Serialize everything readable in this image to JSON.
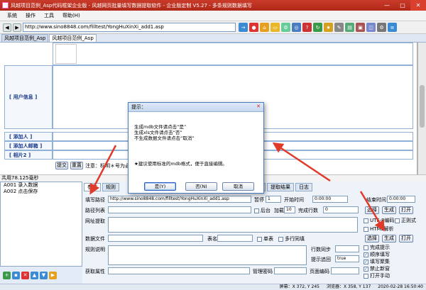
{
  "window": {
    "title": "风越项目范例_Asp代码框架企业版 - 风越网页批量填写数据提取软件 - 企业版定制 V5.27 - 多条规则数据填写"
  },
  "menu": {
    "items": [
      "系统",
      "操作",
      "工具",
      "帮助(H)"
    ]
  },
  "toolbar": {
    "url": "http://www.sino8848.com/filltest/YongHuXinXi_add1.asp",
    "icons": [
      "go-icon",
      "stop-icon",
      "home-icon",
      "folder-icon",
      "settings-icon",
      "globe-icon",
      "help-icon",
      "refresh-icon",
      "bookmark-icon",
      "tools-icon"
    ]
  },
  "tabs": [
    "风越项目范例_Asp",
    "风越项目范例_Asp"
  ],
  "webpage": {
    "rows": [
      {
        "label": "[ 用户信息 ]"
      },
      {
        "label": "[ 添加人 ]"
      },
      {
        "label": "[ 添加人邮箱 ]"
      },
      {
        "label": "[ 相片2 ]"
      }
    ],
    "submit_label": "提交",
    "reset_label": "重置",
    "note": "注意：标明＊号为必填项"
  },
  "status_left": "共用78.125毫秒",
  "tree": {
    "items": [
      "A001 录入数据",
      "A002 点击保存"
    ]
  },
  "panel": {
    "tabs": [
      "参数",
      "规则",
      "提取",
      "提取结果",
      "日志"
    ],
    "fill_path_label": "填写路径",
    "fill_path_value": "http://www.sino8848.com/filltest/YongHuXinXi_add1.asp",
    "path_list_label": "路径列表",
    "url_extract_label": "网址提取",
    "data_file_label": "数据文件",
    "table_name_label": "表名",
    "rule_desc_label": "规则说明",
    "get_attr_label": "获取属性",
    "admin_pwd_label": "管理密码",
    "page_encoding_label": "页面编码",
    "pause_label": "暂停",
    "pause_value": "1",
    "start_time_label": "开始时间",
    "start_time_value": "0:00:00",
    "end_time_label": "结束时间",
    "end_time_value": "0:00:00",
    "backend_label": "后台",
    "load_label": "加载",
    "load_value": "10",
    "done_rows_label": "完成行数",
    "done_rows_value": "0",
    "pages_done_label": "完成页数",
    "pages_done_value": "0",
    "single_table_label": "单表",
    "multi_row_label": "多行同填",
    "rows_sync_label": "行数同步",
    "hint_trace_label": "提示追回",
    "hint_trace_value": "true",
    "select_label": "选择",
    "generate_label": "生成",
    "open_label": "打开",
    "utf8_label": "UTF-8编码",
    "regex_label": "正则式",
    "html_label": "HTML解析",
    "done_hint_label": "完成提示",
    "seq_fill_label": "顺序填写",
    "fill_repeat_label": "填写聚集",
    "block_new_label": "禁止新窗",
    "open_manual_label": "打开手动"
  },
  "bottom_status": {
    "screen": "屏幕：X 372, Y 245",
    "browser": "浏览器：X 358, Y 137",
    "datetime": "2020-02-28 16:50:40"
  },
  "dialog": {
    "title": "提示：",
    "line1": "生成mdb文件请点击“是”",
    "line2": "生成xls文件请点击“否”",
    "line3": "不生成数据文件请点击“取消”",
    "note": "★建议使用标准的mdb格式，便于直接编辑。",
    "yes": "是(Y)",
    "no": "否(N)",
    "cancel": "取消"
  },
  "colors": {
    "title_red": "#c93b2a",
    "accent_blue": "#2a62c4",
    "arrow_red": "#e23a2a"
  }
}
